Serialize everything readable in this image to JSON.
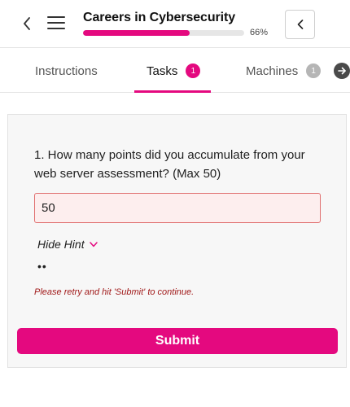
{
  "header": {
    "title": "Careers in Cybersecurity",
    "progress_percent": 66,
    "progress_label": "66%"
  },
  "tabs": [
    {
      "label": "Instructions",
      "badge": null
    },
    {
      "label": "Tasks",
      "badge": "1",
      "active": true
    },
    {
      "label": "Machines",
      "badge": "1"
    }
  ],
  "task": {
    "question": "1. How many points did you accumulate from your web server assessment? (Max 50)",
    "answer_value": "50",
    "hint_toggle_label": "Hide Hint",
    "hint_text": "••",
    "error_message": "Please retry and hit 'Submit' to continue.",
    "submit_label": "Submit"
  },
  "colors": {
    "accent": "#e4097f",
    "error_text": "#a11a1a",
    "input_error_bg": "#fdeeee",
    "input_error_border": "#e07070"
  },
  "icons": {
    "back": "chevron-left-icon",
    "menu": "hamburger-menu-icon",
    "collapse": "chevron-left-icon",
    "tab_next": "arrow-right-circle-icon",
    "hint": "chevron-down-icon"
  }
}
